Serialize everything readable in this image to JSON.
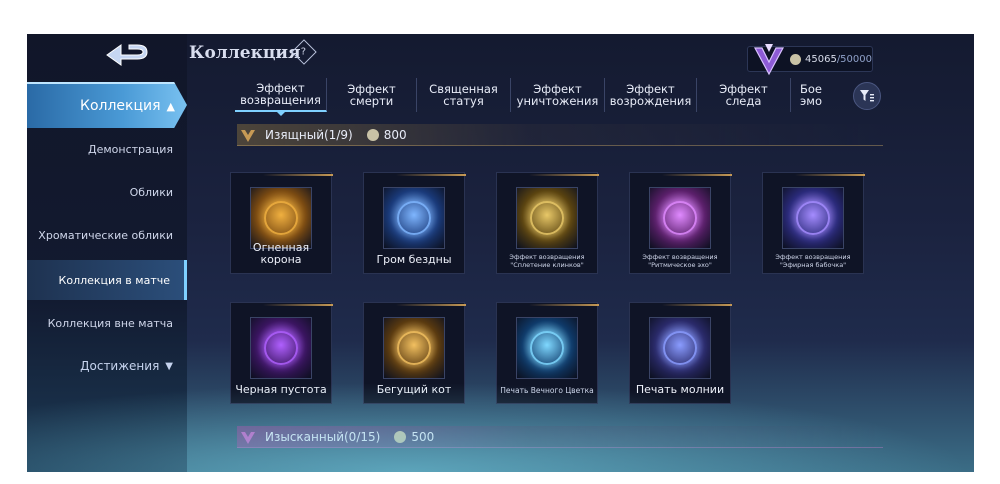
{
  "header": {
    "title": "Коллекция",
    "help_symbol": "?",
    "currency_value": "45065",
    "currency_total": "/50000"
  },
  "sidebar": {
    "main_label": "Коллекция",
    "items": [
      {
        "label": "Демонстрация"
      },
      {
        "label": "Облики"
      },
      {
        "label": "Хроматические облики"
      },
      {
        "label": "Коллекция в матче"
      },
      {
        "label": "Коллекция вне матча"
      }
    ],
    "achievements_label": "Достижения",
    "active_index": 3
  },
  "tabs": [
    {
      "label": "Эффект возвращения"
    },
    {
      "label": "Эффект смерти"
    },
    {
      "label": "Священная статуя"
    },
    {
      "label": "Эффект уничтожения"
    },
    {
      "label": "Эффект возрождения"
    },
    {
      "label": "Эффект следа"
    },
    {
      "label": "Бое эмо"
    }
  ],
  "sections": [
    {
      "label": "Изящный(1/9)",
      "price": "800",
      "color": "#c79a55"
    },
    {
      "label": "Изысканный(0/15)",
      "price": "500",
      "color": "#c561c4"
    }
  ],
  "cards": [
    {
      "name": "Огненная корона",
      "icon": "fire-crown-icon",
      "color_a": "#7a4a12",
      "color_b": "#f0b040"
    },
    {
      "name": "Гром бездны",
      "icon": "abyss-thunder-icon",
      "color_a": "#1a3a7a",
      "color_b": "#7fb6ff"
    },
    {
      "name": "Эффект возвращения \"Сплетение клинков\"",
      "icon": "blade-weave-icon",
      "color_a": "#5a4310",
      "color_b": "#e8c868"
    },
    {
      "name": "Эффект возвращения \"Ритмическое эхо\"",
      "icon": "rhythm-echo-icon",
      "color_a": "#5a1f6a",
      "color_b": "#e08aff"
    },
    {
      "name": "Эффект возвращения \"Эфирная бабочка\"",
      "icon": "ether-butterfly-icon",
      "color_a": "#2a2a7a",
      "color_b": "#a58cff"
    },
    {
      "name": "Черная пустота",
      "icon": "black-void-icon",
      "color_a": "#3a1560",
      "color_b": "#b060ff"
    },
    {
      "name": "Бегущий кот",
      "icon": "running-cat-icon",
      "color_a": "#5a3a10",
      "color_b": "#f2c060"
    },
    {
      "name": "Печать Вечного Цветка",
      "icon": "eternal-flower-seal-icon",
      "color_a": "#0f3a6a",
      "color_b": "#7fd8ff"
    },
    {
      "name": "Печать молнии",
      "icon": "lightning-seal-icon",
      "color_a": "#2a2a6a",
      "color_b": "#8a9cff"
    }
  ]
}
